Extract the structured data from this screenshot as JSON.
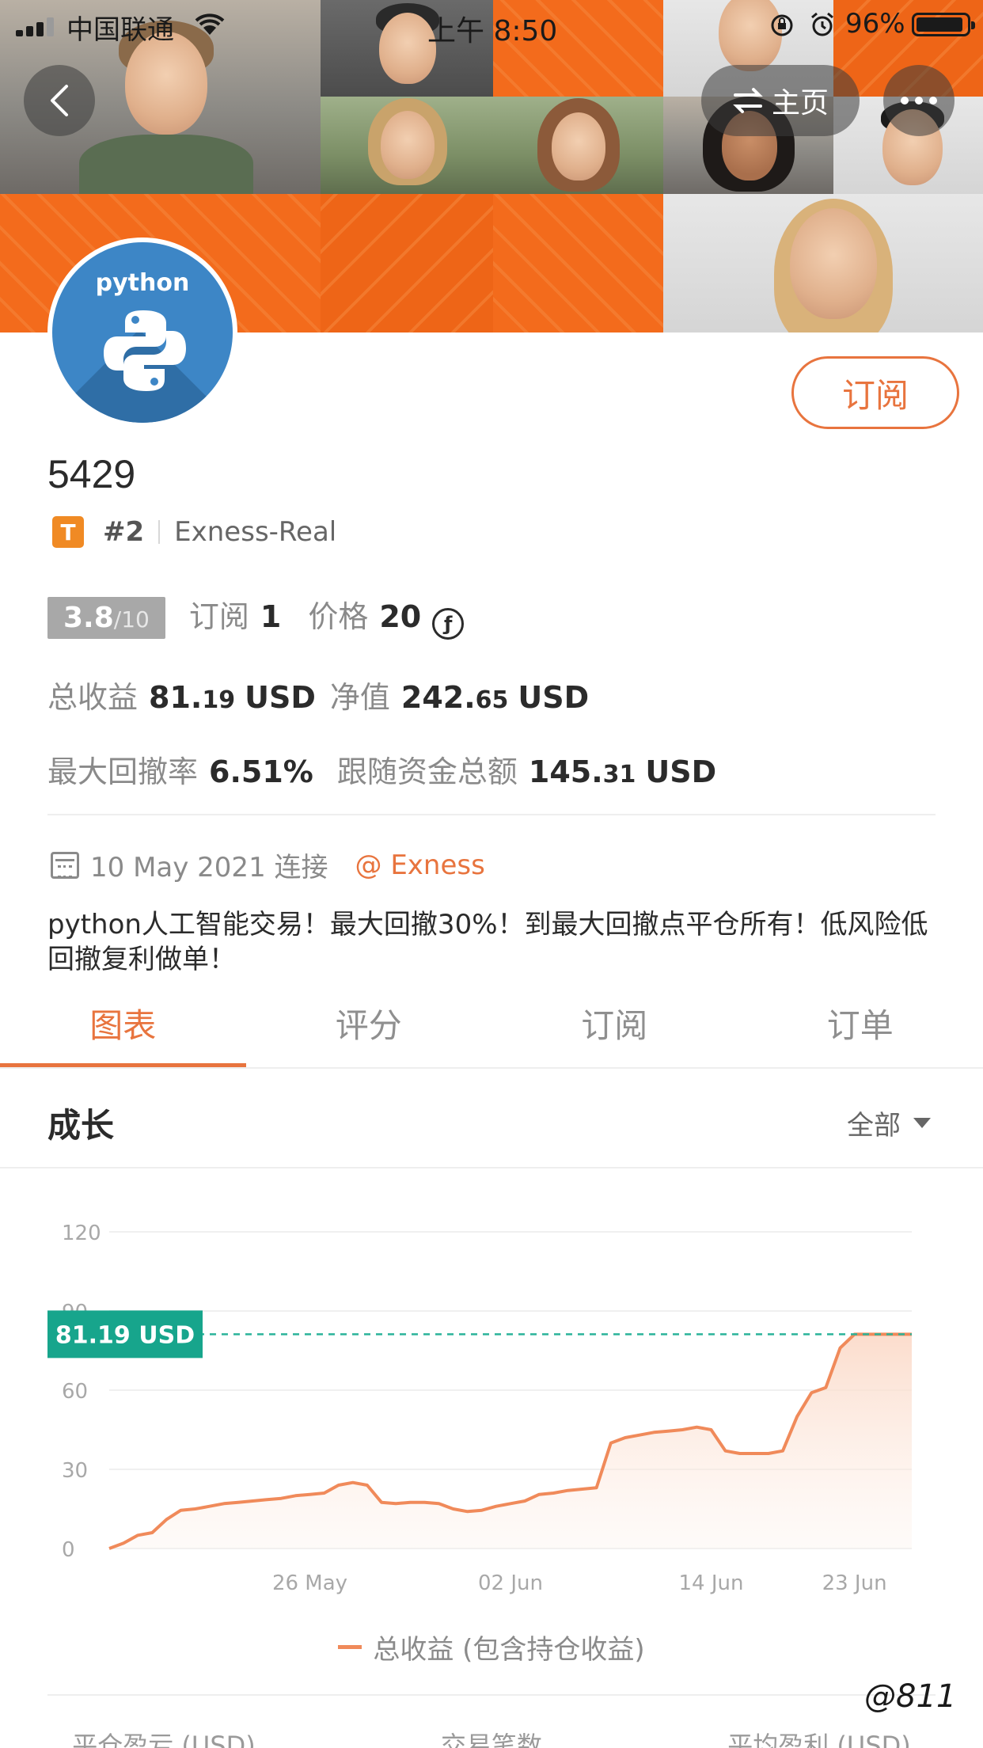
{
  "status_bar": {
    "carrier": "中国联通",
    "time": "上午 8:50",
    "battery": "96%"
  },
  "nav": {
    "home_label": "主页"
  },
  "profile": {
    "avatar_text": "python",
    "name": "5429",
    "tier_badge": "T",
    "rank": "#2",
    "server": "Exness-Real",
    "subscribe_label": "订阅"
  },
  "stats": {
    "score": "3.8",
    "score_max": "/10",
    "subscribe_label": "订阅",
    "subscribe_count": "1",
    "price_label": "价格",
    "price_value": "20",
    "coin_symbol": "ƒ",
    "total_profit_label": "总收益",
    "total_profit_int": "81.",
    "total_profit_dec": "19",
    "total_profit_unit": "USD",
    "equity_label": "净值",
    "equity_int": "242.",
    "equity_dec": "65",
    "equity_unit": "USD",
    "max_drawdown_label": "最大回撤率",
    "max_drawdown_value": "6.51%",
    "follow_funds_label": "跟随资金总额",
    "follow_funds_int": "145.",
    "follow_funds_dec": "31",
    "follow_funds_unit": "USD"
  },
  "connect": {
    "date": "10 May 2021 连接",
    "broker": "@ Exness"
  },
  "description": "python人工智能交易！最大回撤30%！到最大回撤点平仓所有！低风险低回撤复利做单！",
  "tabs": [
    "图表",
    "评分",
    "订阅",
    "订单"
  ],
  "active_tab": 0,
  "growth": {
    "title": "成长",
    "range_label": "全部"
  },
  "chart_data": {
    "type": "area",
    "title": "",
    "xlabel": "",
    "ylabel": "",
    "ylim": [
      0,
      120
    ],
    "y_ticks": [
      0,
      30,
      60,
      90,
      120
    ],
    "y_tick_labels": [
      "0",
      "30",
      "60",
      "90",
      "120"
    ],
    "x_tick_labels": [
      "26 May",
      "02 Jun",
      "14 Jun",
      "23 Jun"
    ],
    "x_tick_positions": [
      7,
      14,
      21,
      26
    ],
    "current_value_label": "81.19 USD",
    "current_value": 81.19,
    "colors": {
      "line": "#f08a5a",
      "fill": "#fde9df",
      "marker_line": "#2bb39a",
      "marker_bg": "#17a58c"
    },
    "series": [
      {
        "name": "总收益 (包含持仓收益)",
        "x": [
          0,
          0.5,
          1,
          1.5,
          2,
          2.5,
          3,
          3.5,
          4,
          4.5,
          5,
          5.5,
          6,
          6.5,
          7,
          7.5,
          8,
          8.5,
          9,
          9.5,
          10,
          10.5,
          11,
          11.5,
          12,
          12.5,
          13,
          13.5,
          14,
          14.5,
          15,
          15.5,
          16,
          16.5,
          17,
          17.5,
          18,
          18.5,
          19,
          19.5,
          20,
          20.5,
          21,
          21.5,
          22,
          22.5,
          23,
          23.5,
          24,
          24.5,
          25,
          25.5,
          26,
          26.5,
          27,
          27.5,
          28
        ],
        "values": [
          0,
          2,
          5,
          6,
          11,
          14.5,
          15,
          16,
          17,
          17.5,
          18,
          18.5,
          19,
          20,
          20.5,
          21,
          24,
          25,
          24,
          17.5,
          17,
          17.5,
          17.5,
          17,
          15,
          14,
          14.5,
          16,
          17,
          18,
          20.5,
          21,
          22,
          22.5,
          23,
          40,
          42,
          43,
          44,
          44.5,
          45,
          46,
          45,
          37,
          36,
          36,
          36,
          37,
          50,
          59,
          61,
          76,
          81.19,
          81.19,
          81.19,
          81.19,
          81.19
        ]
      }
    ],
    "legend_position": "bottom-center",
    "grid": true
  },
  "legend_label": "总收益 (包含持仓收益)",
  "bottom_headers": [
    "平仓盈亏 (USD)",
    "交易笔数",
    "平均盈利 (USD)"
  ],
  "watermark": "@811"
}
